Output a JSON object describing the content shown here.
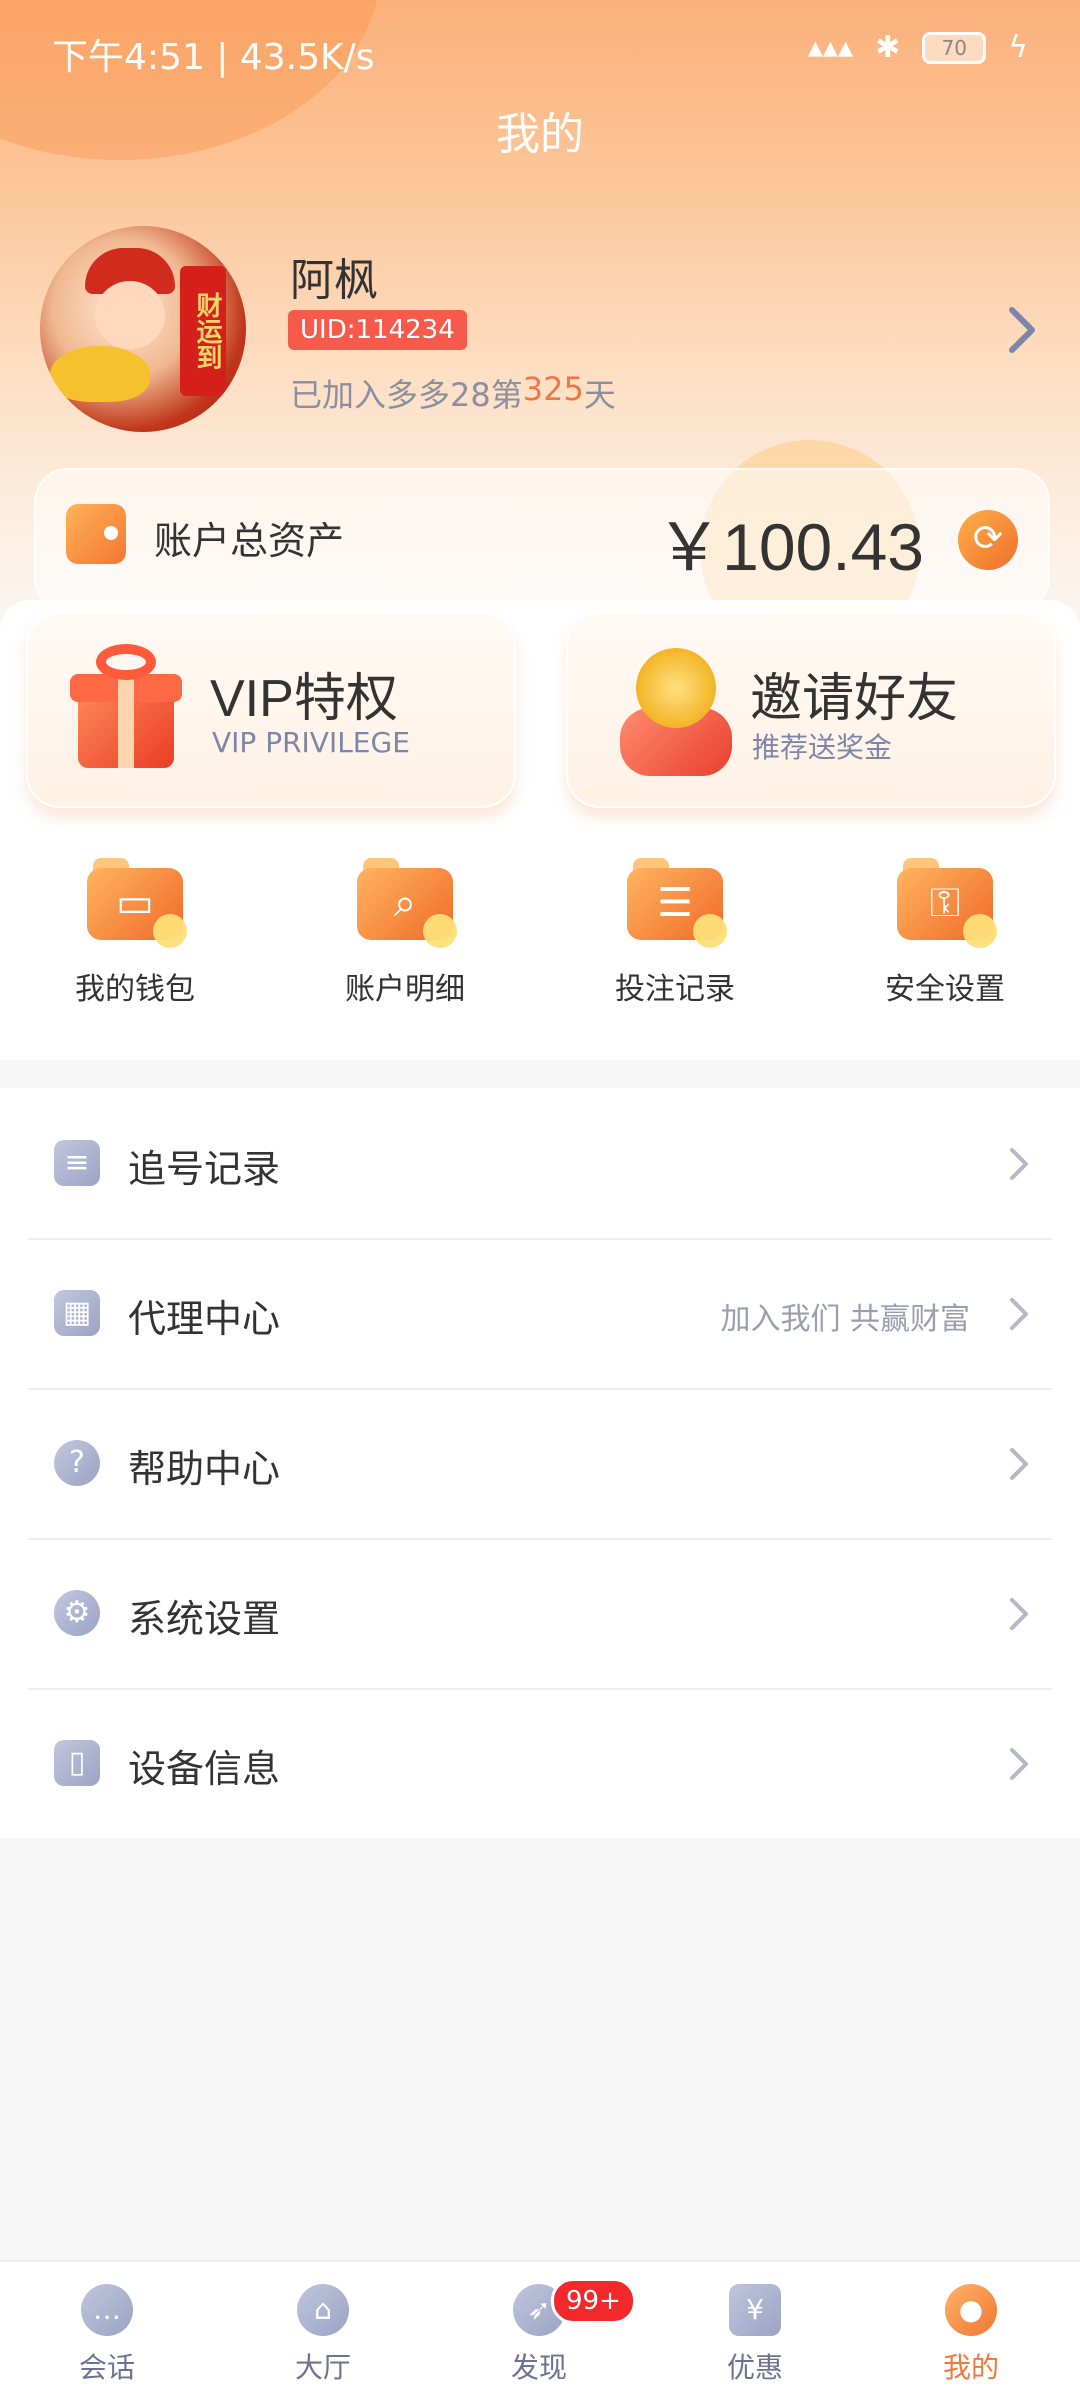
{
  "status_bar": {
    "time_speed": "下午4:51 | 43.5K/s",
    "battery": "70"
  },
  "page": {
    "title": "我的"
  },
  "profile": {
    "name": "阿枫",
    "uid": "UID:114234",
    "join_prefix": "已加入多多28第",
    "join_days": "325",
    "join_suffix": "天",
    "avatar_text": "财运到"
  },
  "assets": {
    "label": "账户总资产",
    "value": "￥100.43"
  },
  "promos": {
    "vip": {
      "title": "VIP特权",
      "subtitle": "VIP PRIVILEGE"
    },
    "invite": {
      "title": "邀请好友",
      "subtitle": "推荐送奖金"
    }
  },
  "quick_actions": [
    {
      "label": "我的钱包",
      "icon": "wallet-icon"
    },
    {
      "label": "账户明细",
      "icon": "magnifier-icon"
    },
    {
      "label": "投注记录",
      "icon": "record-icon"
    },
    {
      "label": "安全设置",
      "icon": "key-icon"
    }
  ],
  "menu": [
    {
      "label": "追号记录",
      "extra": "",
      "icon": "clipboard-icon"
    },
    {
      "label": "代理中心",
      "extra": "加入我们 共赢财富",
      "icon": "qrcode-icon"
    },
    {
      "label": "帮助中心",
      "extra": "",
      "icon": "question-icon"
    },
    {
      "label": "系统设置",
      "extra": "",
      "icon": "gear-icon"
    },
    {
      "label": "设备信息",
      "extra": "",
      "icon": "device-icon"
    }
  ],
  "bottom_nav": [
    {
      "label": "会话",
      "icon": "chat-icon"
    },
    {
      "label": "大厅",
      "icon": "hall-icon"
    },
    {
      "label": "发现",
      "icon": "compass-icon",
      "badge": "99+"
    },
    {
      "label": "优惠",
      "icon": "yen-ticket-icon"
    },
    {
      "label": "我的",
      "icon": "user-icon",
      "active": true
    }
  ],
  "colors": {
    "accent": "#ef7a3b",
    "badge_red": "#f3282a",
    "uid_badge": "#f65a4a",
    "menu_icon": "#9ba3c5"
  }
}
